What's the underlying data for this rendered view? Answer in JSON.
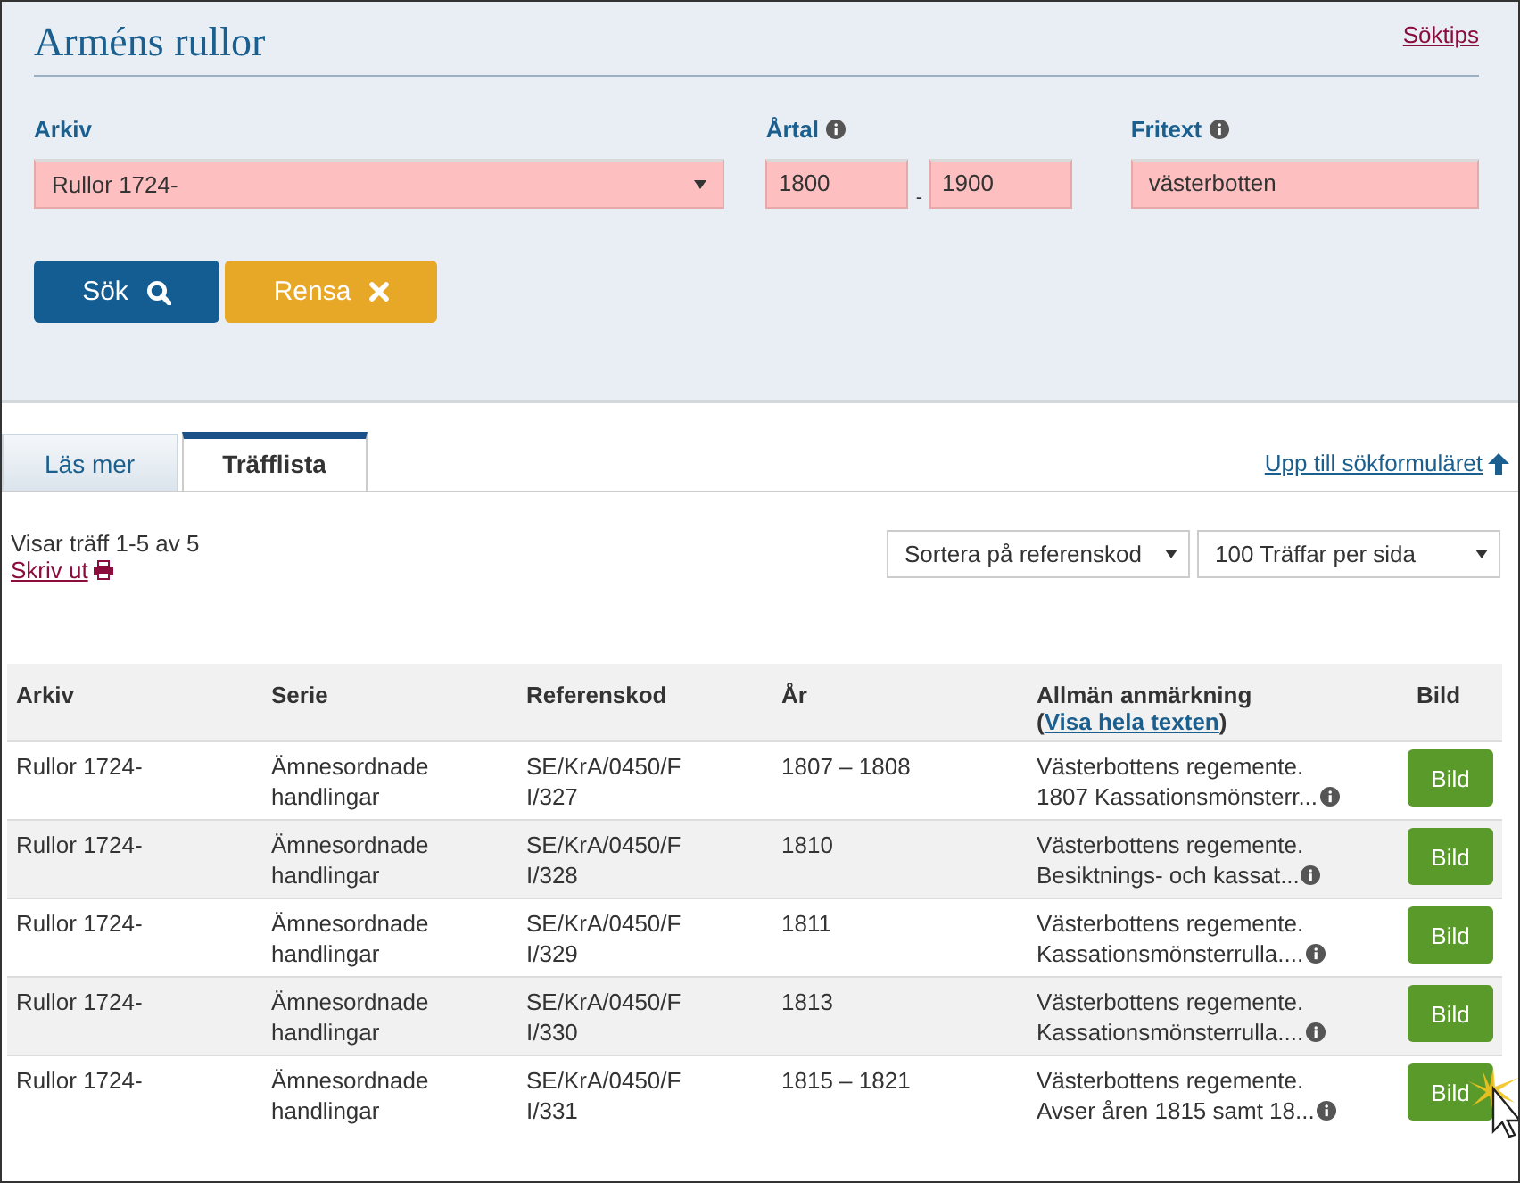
{
  "header": {
    "title": "Arméns rullor",
    "help_link": "Söktips"
  },
  "search_form": {
    "archive": {
      "label": "Arkiv",
      "value": "Rullor 1724-"
    },
    "year": {
      "label": "Årtal",
      "from": "1800",
      "separator": "-",
      "to": "1900"
    },
    "freetext": {
      "label": "Fritext",
      "value": "västerbotten"
    },
    "buttons": [
      {
        "label": "Sök",
        "kind": "search"
      },
      {
        "label": "Rensa",
        "kind": "clear"
      }
    ]
  },
  "tabs": [
    {
      "label": "Läs mer",
      "selected": false
    },
    {
      "label": "Träfflista",
      "selected": true
    }
  ],
  "top_link": "Upp till sökformuläret",
  "summary": "Visar träff 1-5 av 5",
  "print_link": "Skriv ut",
  "sort_selects": [
    "Sortera på referenskod",
    "100 Träffar per sida"
  ],
  "table": {
    "columns": [
      {
        "label": "Arkiv"
      },
      {
        "label": "Serie"
      },
      {
        "label": "Referenskod"
      },
      {
        "label": "År"
      },
      {
        "label": "Allmän anmärkning",
        "sub_open": "(",
        "sub_link": "Visa hela texten",
        "sub_close": ")"
      },
      {
        "label": "Bild"
      }
    ],
    "rows": [
      {
        "archive": "Rullor 1724-",
        "series": "Ämnesordnade handlingar",
        "reference": "SE/KrA/0450/F I/327",
        "years": "1807 – 1808",
        "note": "Västerbottens regemente.\n1807 Kassationsmönsterr...",
        "button": "Bild"
      },
      {
        "archive": "Rullor 1724-",
        "series": "Ämnesordnade handlingar",
        "reference": "SE/KrA/0450/F I/328",
        "years": "1810",
        "note": "Västerbottens regemente.\nBesiktnings- och kassat...",
        "button": "Bild"
      },
      {
        "archive": "Rullor 1724-",
        "series": "Ämnesordnade handlingar",
        "reference": "SE/KrA/0450/F I/329",
        "years": "1811",
        "note": "Västerbottens regemente.\nKassationsmönsterrulla....",
        "button": "Bild"
      },
      {
        "archive": "Rullor 1724-",
        "series": "Ämnesordnade handlingar",
        "reference": "SE/KrA/0450/F I/330",
        "years": "1813",
        "note": "Västerbottens regemente.\nKassationsmönsterrulla....",
        "button": "Bild"
      },
      {
        "archive": "Rullor 1724-",
        "series": "Ämnesordnade handlingar",
        "reference": "SE/KrA/0450/F I/331",
        "years": "1815 – 1821",
        "note": "Västerbottens regemente.\nAvser åren 1815 samt 18...",
        "button": "Bild"
      }
    ]
  }
}
